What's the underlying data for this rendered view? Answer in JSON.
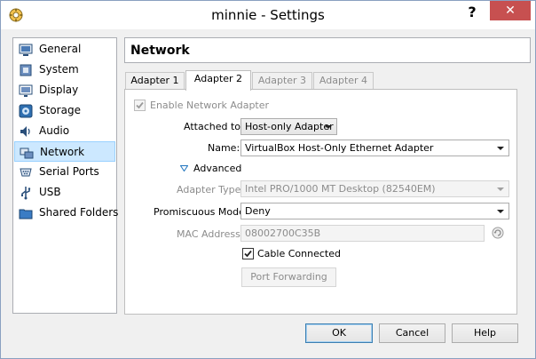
{
  "window": {
    "title": "minnie - Settings",
    "help_label": "?",
    "close_label": "✕"
  },
  "sidebar": {
    "items": [
      {
        "label": "General",
        "icon": "general-icon"
      },
      {
        "label": "System",
        "icon": "system-icon"
      },
      {
        "label": "Display",
        "icon": "display-icon"
      },
      {
        "label": "Storage",
        "icon": "storage-icon"
      },
      {
        "label": "Audio",
        "icon": "audio-icon"
      },
      {
        "label": "Network",
        "icon": "network-icon",
        "selected": true
      },
      {
        "label": "Serial Ports",
        "icon": "serial-ports-icon"
      },
      {
        "label": "USB",
        "icon": "usb-icon"
      },
      {
        "label": "Shared Folders",
        "icon": "shared-folders-icon"
      }
    ]
  },
  "section": {
    "title": "Network"
  },
  "tabs": [
    {
      "label": "Adapter 1",
      "active": false
    },
    {
      "label": "Adapter 2",
      "active": true
    },
    {
      "label": "Adapter 3",
      "active": false,
      "disabled": true
    },
    {
      "label": "Adapter 4",
      "active": false,
      "disabled": true
    }
  ],
  "adapter": {
    "enable_label": "Enable Network Adapter",
    "enable_checked": true,
    "attached_label": "Attached to:",
    "attached_value": "Host-only Adapter",
    "name_label": "Name:",
    "name_value": "VirtualBox Host-Only Ethernet Adapter",
    "advanced_label": "Advanced",
    "adapter_type_label": "Adapter Type:",
    "adapter_type_value": "Intel PRO/1000 MT Desktop (82540EM)",
    "promiscuous_label": "Promiscuous Mode:",
    "promiscuous_value": "Deny",
    "mac_label": "MAC Address:",
    "mac_value": "08002700C35B",
    "cable_label": "Cable Connected",
    "cable_checked": true,
    "port_forwarding_label": "Port Forwarding"
  },
  "buttons": {
    "ok": "OK",
    "cancel": "Cancel",
    "help": "Help"
  },
  "colors": {
    "close_button": "#c75050",
    "selection_bg": "#cce8ff",
    "advanced_arrow": "#1e73be"
  }
}
